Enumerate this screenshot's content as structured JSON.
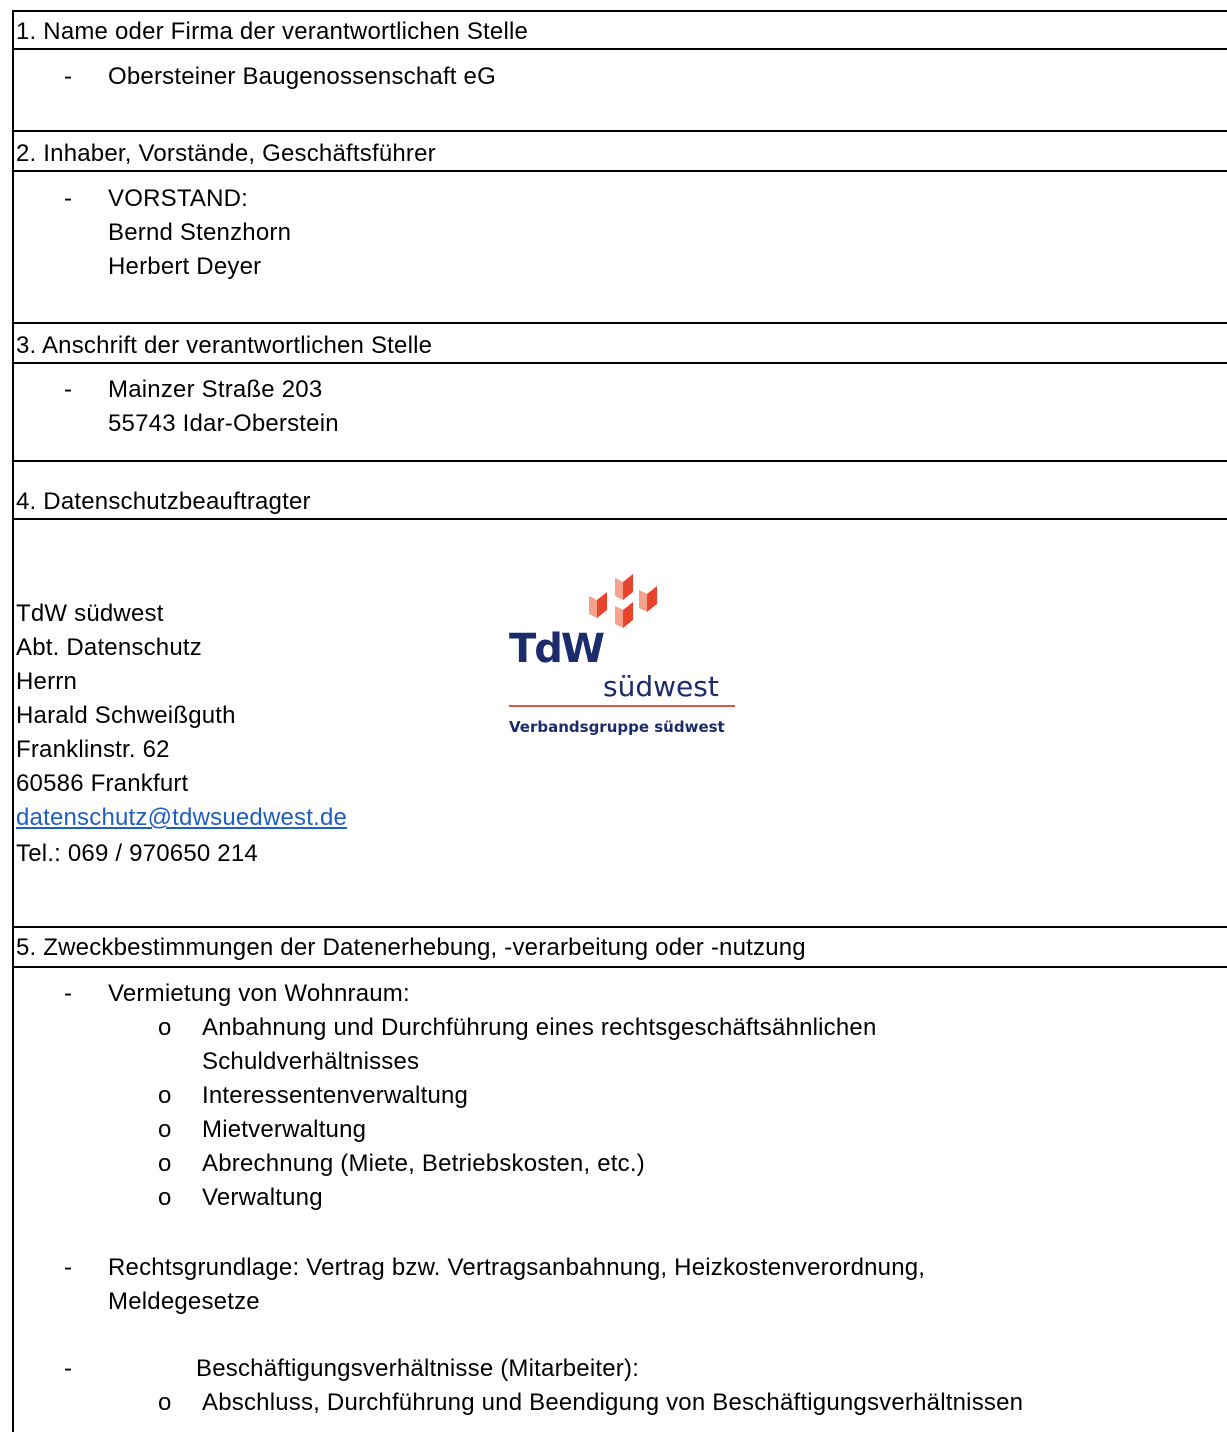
{
  "sections": [
    {
      "heading": "1. Name oder Firma der verantwortlichen Stelle",
      "lines": [
        "Obersteiner Baugenossenschaft eG"
      ]
    },
    {
      "heading": "2. Inhaber, Vorstände, Geschäftsführer",
      "lines": [
        "VORSTAND:",
        "Bernd Stenzhorn",
        "Herbert Deyer"
      ]
    },
    {
      "heading": "3. Anschrift der verantwortlichen Stelle",
      "lines": [
        "Mainzer Straße 203",
        "55743 Idar-Oberstein"
      ]
    },
    {
      "heading": "4. Datenschutzbeauftragter",
      "lines": [
        "TdW südwest",
        "Abt. Datenschutz",
        "Herrn",
        "Harald Schweißguth",
        "Franklinstr. 62",
        "60586 Frankfurt",
        "datenschutz@tdwsuedwest.de",
        "Tel.: 069 / 970650 214"
      ]
    },
    {
      "heading": "5. Zweckbestimmungen der Datenerhebung, -verarbeitung oder -nutzung",
      "lines": [
        "Vermietung von Wohnraum:",
        "Anbahnung und Durchführung eines rechtsgeschäftsähnlichen",
        "Schuldverhältnisses",
        "Interessentenverwaltung",
        "Mietverwaltung",
        "Abrechnung (Miete, Betriebskosten, etc.)",
        "Verwaltung",
        "Rechtsgrundlage: Vertrag bzw. Vertragsanbahnung, Heizkostenverordnung,",
        "Meldegesetze",
        "Beschäftigungsverhältnisse (Mitarbeiter):",
        "Abschluss, Durchführung und Beendigung von Beschäftigungsverhältnissen"
      ]
    }
  ],
  "markers": {
    "dash": "-",
    "bullet": "o"
  },
  "logo": {
    "wordmark": "TdW",
    "subtitle": "südwest",
    "tagline": "Verbandsgruppe südwest",
    "colors": {
      "navy": "#1b2b6b",
      "red": "#e8442c",
      "orange": "#f4a08a",
      "rule": "#d9534f"
    }
  },
  "colors": {
    "link": "#1f5fbf"
  }
}
